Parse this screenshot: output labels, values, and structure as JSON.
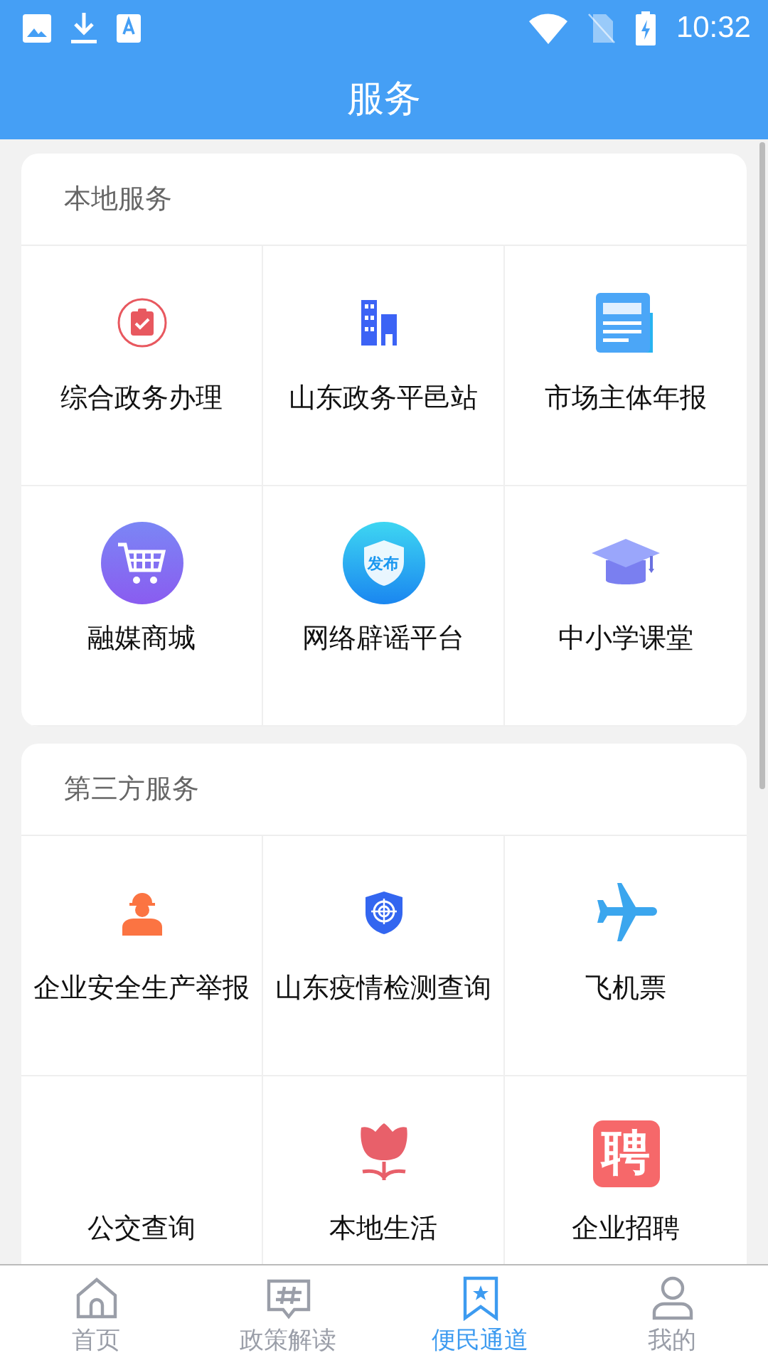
{
  "status_bar": {
    "time": "10:32"
  },
  "header": {
    "title": "服务"
  },
  "sections": [
    {
      "title": "本地服务",
      "items": [
        {
          "label": "综合政务办理",
          "kind": "clipboard"
        },
        {
          "label": "山东政务平邑站",
          "kind": "building"
        },
        {
          "label": "市场主体年报",
          "kind": "document"
        },
        {
          "label": "融媒商城",
          "kind": "cart"
        },
        {
          "label": "网络辟谣平台",
          "kind": "shield",
          "badge": "发布"
        },
        {
          "label": "中小学课堂",
          "kind": "cap"
        }
      ]
    },
    {
      "title": "第三方服务",
      "items": [
        {
          "label": "企业安全生产举报",
          "kind": "worker"
        },
        {
          "label": "山东疫情检测查询",
          "kind": "target"
        },
        {
          "label": "飞机票",
          "kind": "plane"
        },
        {
          "label": "公交查询",
          "kind": "none"
        },
        {
          "label": "本地生活",
          "kind": "tulip"
        },
        {
          "label": "企业招聘",
          "kind": "hire",
          "badge": "聘"
        }
      ]
    }
  ],
  "tabs": [
    {
      "label": "首页",
      "kind": "home",
      "selected": false
    },
    {
      "label": "政策解读",
      "kind": "hash",
      "selected": false
    },
    {
      "label": "便民通道",
      "kind": "bookmark",
      "selected": true
    },
    {
      "label": "我的",
      "kind": "user",
      "selected": false
    }
  ]
}
